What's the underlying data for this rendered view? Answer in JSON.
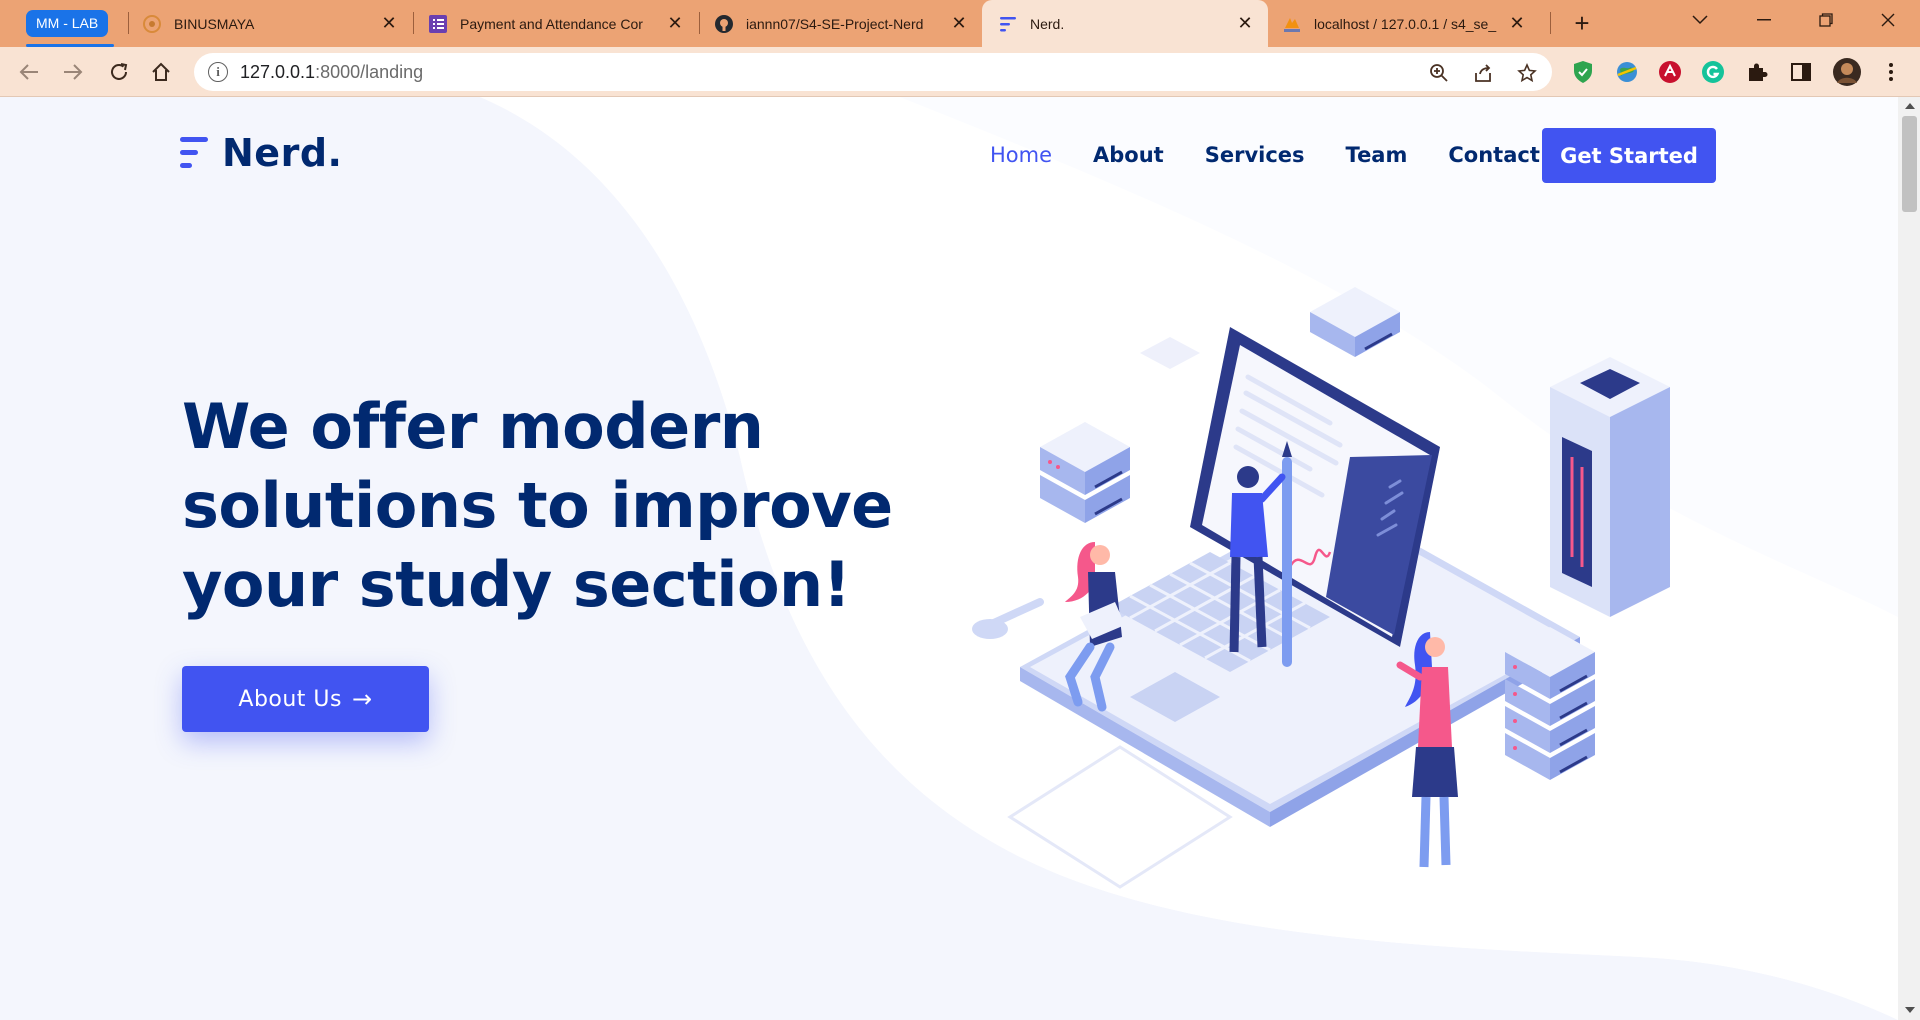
{
  "browser": {
    "tab_group_label": "MM - LAB",
    "tabs": [
      {
        "title": "BINUSMAYA",
        "icon": "binusmaya-icon"
      },
      {
        "title": "Payment and Attendance Cor",
        "icon": "forms-icon"
      },
      {
        "title": "iannn07/S4-SE-Project-Nerd",
        "icon": "github-icon"
      },
      {
        "title": "Nerd.",
        "icon": "nerd-logo-icon",
        "active": true
      },
      {
        "title": "localhost / 127.0.0.1 / s4_se_",
        "icon": "phpmyadmin-icon"
      }
    ],
    "url_host": "127.0.0.1",
    "url_rest": ":8000/landing"
  },
  "page": {
    "brand": "Nerd.",
    "nav": {
      "home": "Home",
      "about": "About",
      "services": "Services",
      "team": "Team",
      "contact": "Contact"
    },
    "cta_label": "Get Started",
    "headline_lines": [
      "We offer modern",
      "solutions to improve",
      "your study section!"
    ],
    "about_button": "About Us",
    "about_arrow": "→"
  },
  "colors": {
    "accent": "#4154f1",
    "heading": "#012970",
    "tabstrip": "#ECA374",
    "toolbar": "#F9E3D3"
  }
}
